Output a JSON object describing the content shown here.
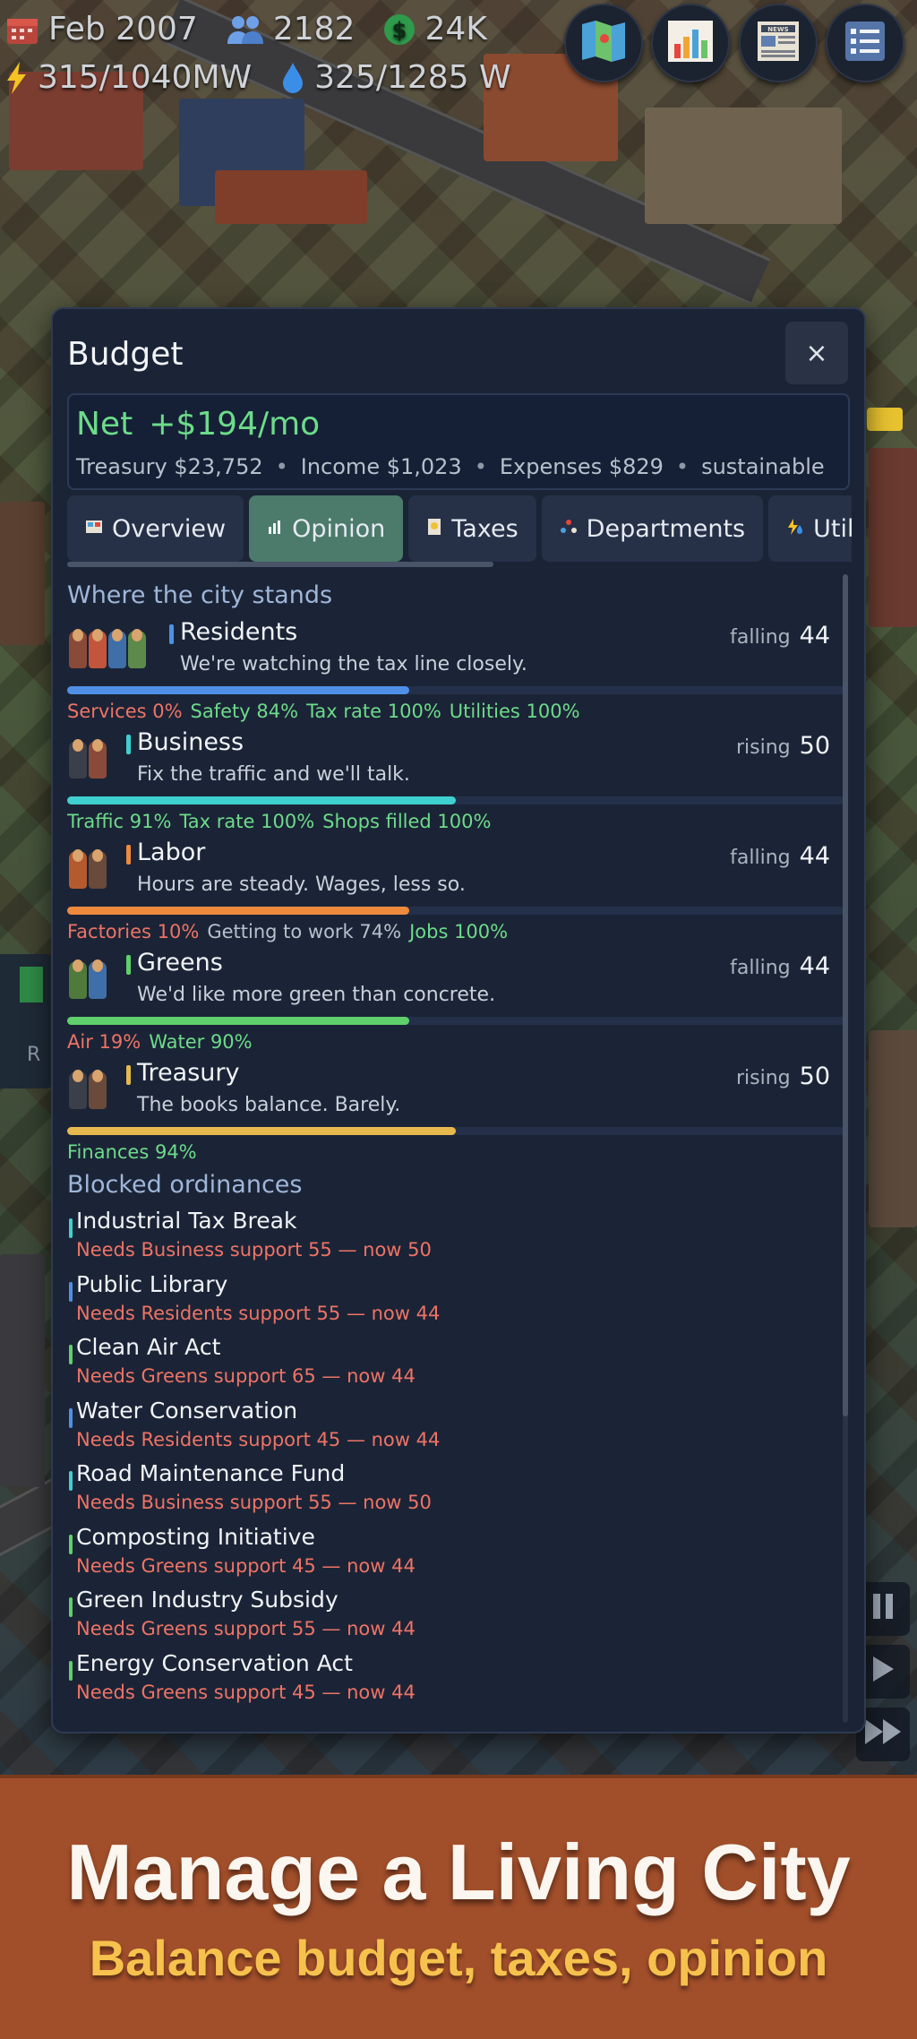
{
  "hud": {
    "date": "Feb 2007",
    "population": "2182",
    "money": "24K",
    "power": "315/1040MW",
    "water": "325/1285 W",
    "buttons": [
      "map-icon",
      "chart-icon",
      "news-icon",
      "list-icon"
    ]
  },
  "budget": {
    "title": "Budget",
    "close_label": "×",
    "net_label": "Net",
    "net_value": "+$194/mo",
    "treasury": "Treasury $23,752",
    "income": "Income $1,023",
    "expenses": "Expenses $829",
    "status": "sustainable",
    "separator": "•",
    "tabs": [
      {
        "label": "Overview",
        "icon": "overview-icon",
        "active": false
      },
      {
        "label": "Opinion",
        "icon": "opinion-icon",
        "active": true
      },
      {
        "label": "Taxes",
        "icon": "taxes-icon",
        "active": false
      },
      {
        "label": "Departments",
        "icon": "departments-icon",
        "active": false
      },
      {
        "label": "Utilities",
        "icon": "utilities-icon",
        "active": false
      }
    ]
  },
  "opinion": {
    "heading": "Where the city stands",
    "factions": [
      {
        "name": "Residents",
        "quote": "We're watching the tax line closely.",
        "trend": "falling",
        "score": "44",
        "support": 0.44,
        "color": "#4f90e6",
        "factors": [
          {
            "text": "Services 0%",
            "tone": "bad"
          },
          {
            "text": "Safety 84%",
            "tone": "good"
          },
          {
            "text": "Tax rate 100%",
            "tone": "good"
          },
          {
            "text": "Utilities 100%",
            "tone": "good"
          }
        ]
      },
      {
        "name": "Business",
        "quote": "Fix the traffic and we'll talk.",
        "trend": "rising",
        "score": "50",
        "support": 0.5,
        "color": "#3fd0cf",
        "factors": [
          {
            "text": "Traffic 91%",
            "tone": "good"
          },
          {
            "text": "Tax rate 100%",
            "tone": "good"
          },
          {
            "text": "Shops filled 100%",
            "tone": "good"
          }
        ]
      },
      {
        "name": "Labor",
        "quote": "Hours are steady. Wages, less so.",
        "trend": "falling",
        "score": "44",
        "support": 0.44,
        "color": "#ef8a3d",
        "factors": [
          {
            "text": "Factories 10%",
            "tone": "bad"
          },
          {
            "text": "Getting to work 74%",
            "tone": "neu"
          },
          {
            "text": "Jobs 100%",
            "tone": "good"
          }
        ]
      },
      {
        "name": "Greens",
        "quote": "We'd like more green than concrete.",
        "trend": "falling",
        "score": "44",
        "support": 0.44,
        "color": "#5fd06b",
        "factors": [
          {
            "text": "Air 19%",
            "tone": "bad"
          },
          {
            "text": "Water 90%",
            "tone": "good"
          }
        ]
      },
      {
        "name": "Treasury",
        "quote": "The books balance. Barely.",
        "trend": "rising",
        "score": "50",
        "support": 0.5,
        "color": "#e7b84e",
        "factors": [
          {
            "text": "Finances 94%",
            "tone": "good"
          }
        ]
      }
    ],
    "blocked_heading": "Blocked ordinances",
    "blocked": [
      {
        "name": "Industrial Tax Break",
        "need": "Needs Business support 55 — now 50",
        "color": "#3fd0cf"
      },
      {
        "name": "Public Library",
        "need": "Needs Residents support 55 — now 44",
        "color": "#4f90e6"
      },
      {
        "name": "Clean Air Act",
        "need": "Needs Greens support 65 — now 44",
        "color": "#5fd06b"
      },
      {
        "name": "Water Conservation",
        "need": "Needs Residents support 45 — now 44",
        "color": "#4f90e6"
      },
      {
        "name": "Road Maintenance Fund",
        "need": "Needs Business support 55 — now 50",
        "color": "#3fd0cf"
      },
      {
        "name": "Composting Initiative",
        "need": "Needs Greens support 45 — now 44",
        "color": "#5fd06b"
      },
      {
        "name": "Green Industry Subsidy",
        "need": "Needs Greens support 55 — now 44",
        "color": "#5fd06b"
      },
      {
        "name": "Energy Conservation Act",
        "need": "Needs Greens support 45 — now 44",
        "color": "#5fd06b"
      }
    ]
  },
  "side": {
    "label": "R"
  },
  "banner": {
    "headline": "Manage a Living City",
    "subline": "Balance budget, taxes, opinion"
  }
}
